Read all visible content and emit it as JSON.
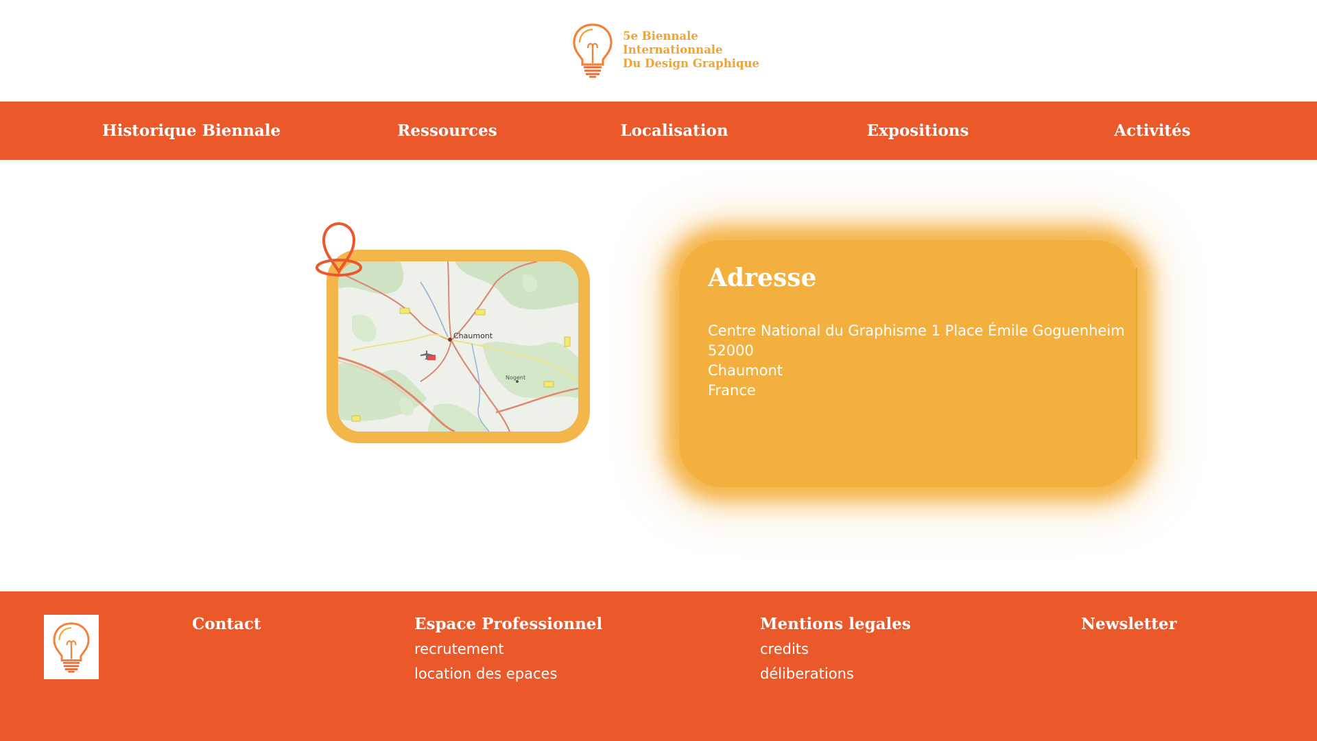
{
  "brand": {
    "line1": "5e Biennale",
    "line2": "Internationnale",
    "line3": "Du Design Graphique",
    "accent": "#f2a232",
    "logo_icon": "lightbulb-icon"
  },
  "nav": {
    "items": [
      {
        "label": "Historique Biennale"
      },
      {
        "label": "Ressources"
      },
      {
        "label": "Localisation"
      },
      {
        "label": "Expositions"
      },
      {
        "label": "Activités"
      }
    ],
    "background": "#eb582a"
  },
  "map": {
    "city_label": "Chaumont",
    "town_label": "Nogent",
    "pin_icon": "map-pin-icon",
    "frame_color": "#f3b64a"
  },
  "address": {
    "title": "Adresse",
    "lines": [
      "Centre National du Graphisme 1 Place Émile Goguenheim",
      "52000",
      "Chaumont",
      "France"
    ],
    "card_color": "#f4b03f"
  },
  "footer": {
    "logo_icon": "lightbulb-icon",
    "contact": "Contact",
    "pro": {
      "title": "Espace Professionnel",
      "links": [
        "recrutement",
        "location des epaces"
      ]
    },
    "legal": {
      "title": "Mentions legales",
      "links": [
        "credits",
        "déliberations"
      ]
    },
    "newsletter": "Newsletter",
    "background": "#eb582a"
  }
}
